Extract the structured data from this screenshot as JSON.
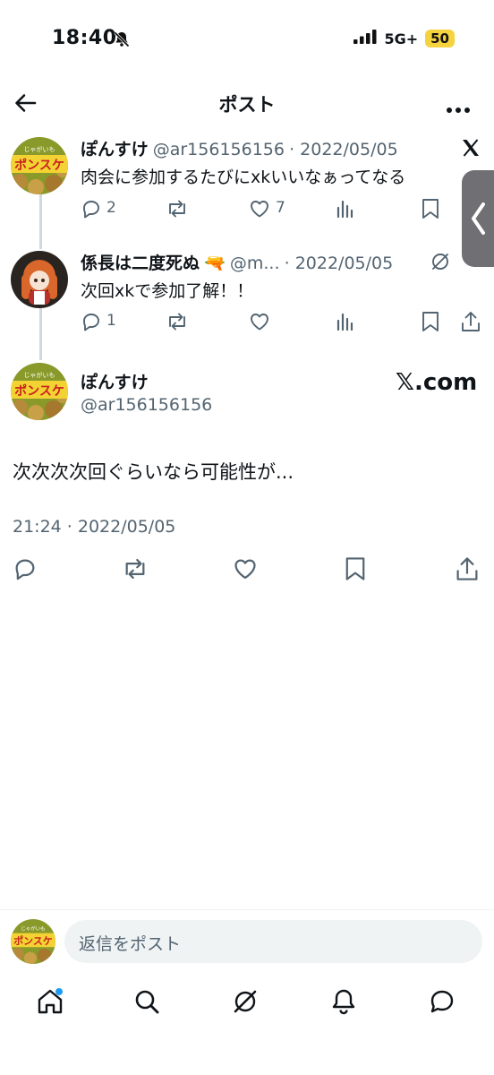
{
  "status_bar": {
    "time": "18:40",
    "network": "5G+",
    "battery": "50"
  },
  "header": {
    "title": "ポスト"
  },
  "posts": [
    {
      "name": "ぽんすけ",
      "handle": "@ar156156156",
      "date": "· 2022/05/05",
      "text": "肉会に参加するたびにxkいいなぁってなる",
      "replies": "2",
      "likes": "7"
    },
    {
      "name": "係長は二度死ぬ",
      "emoji": "🔫",
      "handle": "@m...",
      "date": "· 2022/05/05",
      "text": "次回xkで参加了解！！",
      "replies": "1"
    }
  ],
  "main_post": {
    "name": "ぽんすけ",
    "handle": "@ar156156156",
    "badge": "𝕏.com",
    "text": "次次次次回ぐらいなら可能性が...",
    "timestamp": "21:24 · 2022/05/05"
  },
  "avatar_text": {
    "top": "じゃがいも",
    "main": "ポンスケ"
  },
  "reply": {
    "placeholder": "返信をポスト"
  },
  "colors": {
    "accent": "#1d9bf0",
    "text": "#0f1419",
    "muted": "#536471"
  }
}
